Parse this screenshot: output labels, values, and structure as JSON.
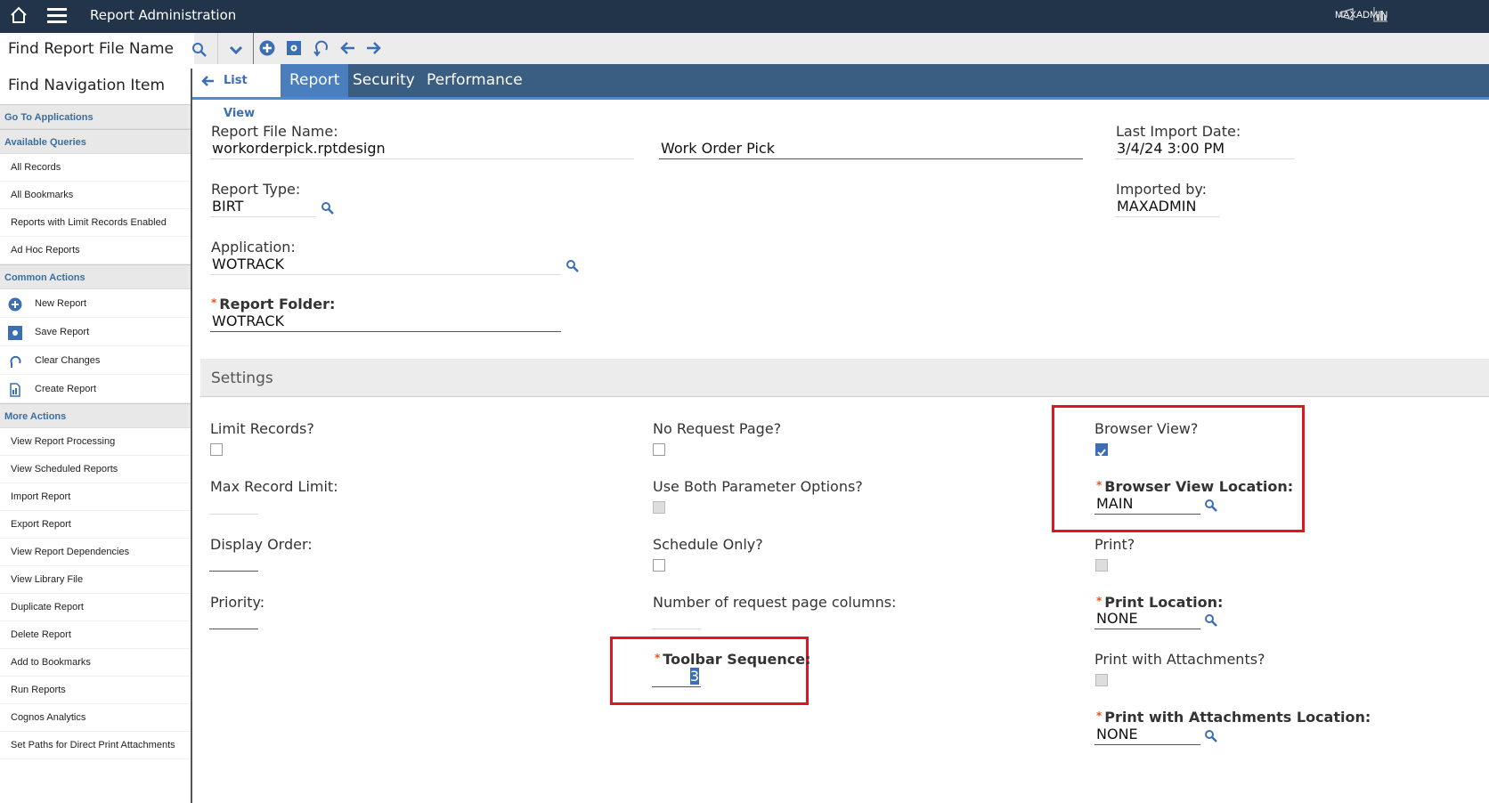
{
  "header": {
    "title": "Report Administration",
    "user": "MAXADMIN"
  },
  "toolbar": {
    "find_placeholder": "Find Report File Name"
  },
  "sidebar": {
    "find_placeholder": "Find Navigation Item",
    "go_to": "Go To Applications",
    "available_queries": "Available Queries",
    "queries": [
      "All Records",
      "All Bookmarks",
      "Reports with Limit Records Enabled",
      "Ad Hoc Reports"
    ],
    "common_actions": "Common Actions",
    "actions": [
      "New Report",
      "Save Report",
      "Clear Changes",
      "Create Report"
    ],
    "more_actions": "More Actions",
    "more": [
      "View Report Processing",
      "View Scheduled Reports",
      "Import Report",
      "Export Report",
      "View Report Dependencies",
      "View Library File",
      "Duplicate Report",
      "Delete Report",
      "Add to Bookmarks",
      "Run Reports",
      "Cognos Analytics",
      "Set Paths for Direct Print Attachments"
    ]
  },
  "tabs": {
    "list_view": "List View",
    "items": [
      "Report",
      "Security",
      "Performance"
    ]
  },
  "form": {
    "report_file_name_label": "Report File Name:",
    "report_file_name": "workorderpick.rptdesign",
    "description": "Work Order Pick",
    "last_import_label": "Last Import Date:",
    "last_import": "3/4/24 3:00 PM",
    "report_type_label": "Report Type:",
    "report_type": "BIRT",
    "imported_by_label": "Imported by:",
    "imported_by": "MAXADMIN",
    "application_label": "Application:",
    "application": "WOTRACK",
    "folder_label": "Report Folder:",
    "folder": "WOTRACK"
  },
  "settings": {
    "title": "Settings",
    "limit_records": "Limit Records?",
    "max_record_limit": "Max Record Limit:",
    "display_order": "Display Order:",
    "priority": "Priority:",
    "no_request_page": "No Request Page?",
    "use_both": "Use Both Parameter Options?",
    "schedule_only": "Schedule Only?",
    "num_columns": "Number of request page columns:",
    "toolbar_sequence_label": "Toolbar Sequence:",
    "toolbar_sequence": "3",
    "browser_view": "Browser View?",
    "browser_view_checked": true,
    "browser_view_location_label": "Browser View Location:",
    "browser_view_location": "MAIN",
    "print": "Print?",
    "print_location_label": "Print Location:",
    "print_location": "NONE",
    "print_attach": "Print with Attachments?",
    "print_attach_location_label": "Print with Attachments Location:",
    "print_attach_location": "NONE"
  }
}
